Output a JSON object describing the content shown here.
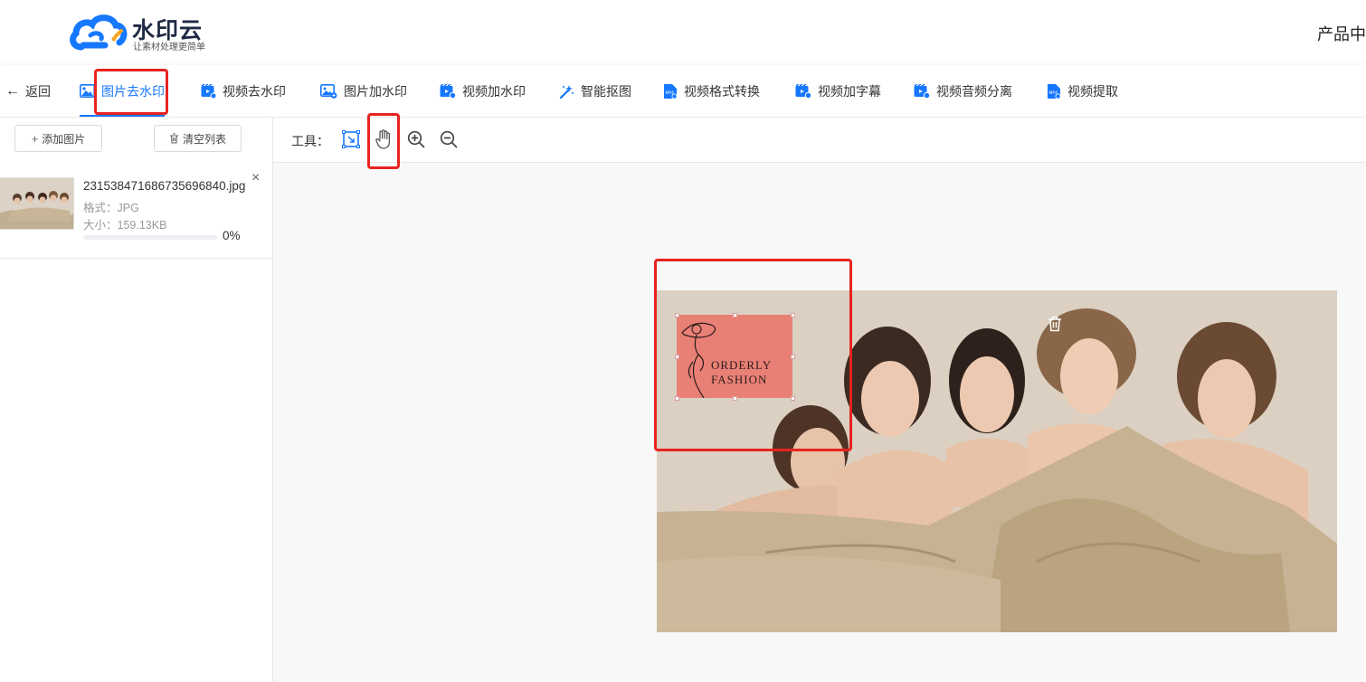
{
  "header": {
    "brand": "水印云",
    "slogan": "让素材处理更简单",
    "right_link": "产品中"
  },
  "nav": {
    "back": "返回",
    "items": [
      {
        "label": "图片去水印",
        "icon": "image-icon",
        "active": true
      },
      {
        "label": "视频去水印",
        "icon": "video-icon",
        "active": false
      },
      {
        "label": "图片加水印",
        "icon": "image-add-icon",
        "active": false
      },
      {
        "label": "视频加水印",
        "icon": "video-add-icon",
        "active": false
      },
      {
        "label": "智能抠图",
        "icon": "magic-wand-icon",
        "active": false
      },
      {
        "label": "视频格式转换",
        "icon": "mp4-file-icon",
        "active": false
      },
      {
        "label": "视频加字幕",
        "icon": "video-subtitle-icon",
        "active": false
      },
      {
        "label": "视频音频分离",
        "icon": "video-audio-icon",
        "active": false
      },
      {
        "label": "视频提取",
        "icon": "mp4-file-icon",
        "active": false
      }
    ]
  },
  "left": {
    "add_button": "添加图片",
    "clear_button": "清空列表",
    "file": {
      "name": "2315384716867356968​40.jpg",
      "format": "格式：JPG",
      "size": "大小：159.13KB",
      "progress": 0,
      "progress_text": "0%"
    }
  },
  "toolbar": {
    "label": "工具：",
    "tools": [
      "select-rect-icon",
      "hand-pan-icon",
      "zoom-in-icon",
      "zoom-out-icon"
    ]
  },
  "canvas": {
    "watermark_text_1": "ORDERLY",
    "watermark_text_2": "FASHION"
  },
  "colors": {
    "accent": "#1677ff",
    "highlight": "#e8231f",
    "selection": "#ec6e64"
  }
}
